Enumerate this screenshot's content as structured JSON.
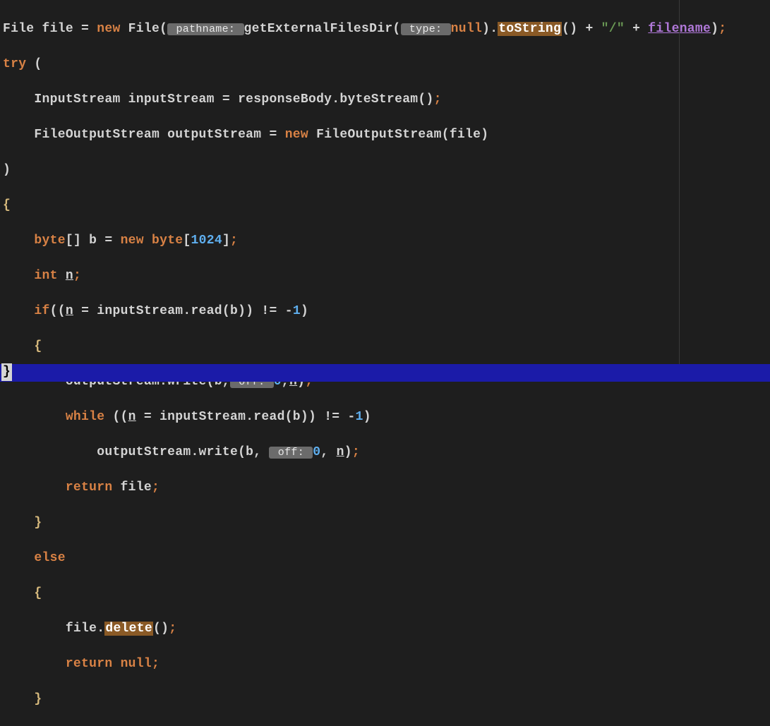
{
  "lines": {
    "l1": {
      "t1": "File file = ",
      "kw1": "new",
      "t2": " File(",
      "hint1": " pathname: ",
      "t3": "getExternalFilesDir(",
      "hint2": " type: ",
      "kw2": "null",
      "t4": ").",
      "hl1": "toString",
      "t5": "() + ",
      "str1": "\"/\"",
      "t6": " + ",
      "purp1": "filename",
      "t7": ")",
      "semi": ";"
    },
    "l2": {
      "kw1": "try",
      "t1": " ("
    },
    "l3": {
      "ind": "    ",
      "t1": "InputStream inputStream = responseBody.byteStream()",
      "semi": ";"
    },
    "l4": {
      "ind": "    ",
      "t1": "FileOutputStream outputStream = ",
      "kw1": "new",
      "t2": " FileOutputStream(file)"
    },
    "l5": {
      "t1": ")"
    },
    "l6": {
      "brace": "{"
    },
    "l7": {
      "ind": "    ",
      "kw1": "byte",
      "t1": "[] b = ",
      "kw2": "new",
      "t2": " ",
      "kw3": "byte",
      "t3": "[",
      "num1": "1024",
      "t4": "]",
      "semi": ";"
    },
    "l8": {
      "ind": "    ",
      "kw1": "int",
      "t1": " ",
      "u1": "n",
      "semi": ";"
    },
    "l9": {
      "ind": "    ",
      "kw1": "if",
      "t1": "((",
      "u1": "n",
      "t2": " = inputStream.read(b)) != -",
      "num1": "1",
      "t3": ")"
    },
    "l10": {
      "ind": "    ",
      "brace": "{"
    },
    "l11": {
      "ind": "        ",
      "t1": "outputStream.write(b,",
      "hint1": " off: ",
      "num1": "0",
      "t2": ",",
      "u1": "n",
      "t3": ")",
      "semi": ";"
    },
    "l12": {
      "ind": "        ",
      "kw1": "while",
      "t1": " ((",
      "u1": "n",
      "t2": " = inputStream.read(b)) != -",
      "num1": "1",
      "t3": ")"
    },
    "l13": {
      "ind": "            ",
      "t1": "outputStream.write(b, ",
      "hint1": " off: ",
      "num1": "0",
      "t2": ", ",
      "u1": "n",
      "t3": ")",
      "semi": ";"
    },
    "l14": {
      "ind": "        ",
      "kw1": "return",
      "t1": " file",
      "semi": ";"
    },
    "l15": {
      "ind": "    ",
      "brace": "}"
    },
    "l16": {
      "ind": "    ",
      "kw1": "else"
    },
    "l17": {
      "ind": "    ",
      "brace": "{"
    },
    "l18": {
      "ind": "        ",
      "t1": "file.",
      "hl1": "delete",
      "t2": "()",
      "semi": ";"
    },
    "l19": {
      "ind": "        ",
      "kw1": "return",
      "t1": " ",
      "kw2": "null",
      "semi": ";"
    },
    "l20": {
      "ind": "    ",
      "brace": "}"
    },
    "cursor": "}"
  },
  "colors": {
    "background": "#1e1e1e",
    "keyword": "#d98245",
    "number": "#5fafef",
    "string": "#6a9955",
    "brace": "#d7ba7d",
    "hint_bg": "#6b6b6b",
    "highlight_bg": "#8a5a26",
    "purple": "#b078d8",
    "cursor_row": "#1b1ba8"
  }
}
